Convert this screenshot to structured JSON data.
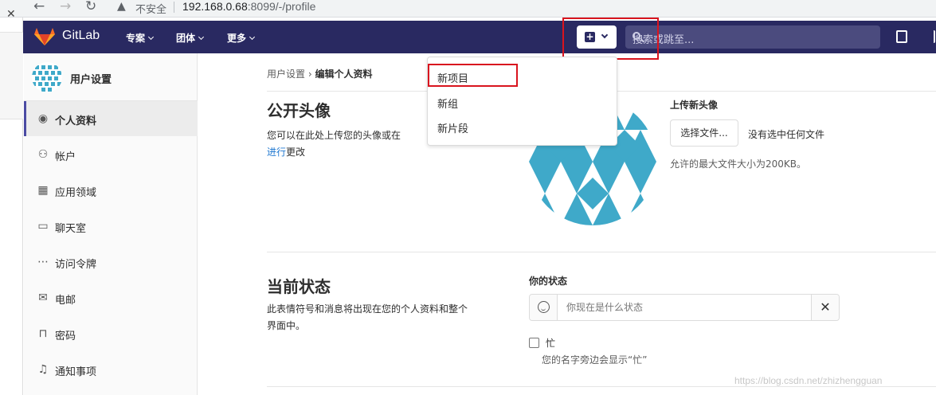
{
  "browser": {
    "back_icon": "back-arrow-icon",
    "forward_icon": "forward-arrow-icon",
    "reload_icon": "reload-icon",
    "insecure_label": "不安全",
    "url_host": "192.168.0.68",
    "url_path": ":8099/-/profile"
  },
  "navbar": {
    "brand": "GitLab",
    "menus": [
      "专案",
      "团体",
      "更多"
    ],
    "search_placeholder": "搜索或跳至..."
  },
  "dropdown": {
    "items": [
      "新项目",
      "新组",
      "新片段"
    ]
  },
  "sidebar": {
    "title": "用户设置",
    "items": [
      {
        "label": "个人资料",
        "icon": "profile-icon",
        "active": true
      },
      {
        "label": "帐户",
        "icon": "account-icon"
      },
      {
        "label": "应用领域",
        "icon": "applications-icon"
      },
      {
        "label": "聊天室",
        "icon": "chat-icon"
      },
      {
        "label": "访问令牌",
        "icon": "token-icon"
      },
      {
        "label": "电邮",
        "icon": "email-icon"
      },
      {
        "label": "密码",
        "icon": "lock-icon"
      },
      {
        "label": "通知事项",
        "icon": "bell-icon"
      }
    ]
  },
  "breadcrumb": {
    "parent": "用户设置",
    "current": "编辑个人资料"
  },
  "avatar_section": {
    "heading": "公开头像",
    "desc_line1": "您可以在此处上传您的头像或在",
    "desc_link_partial": "进行",
    "desc_suffix": "更改",
    "upload_title": "上传新头像",
    "choose_button": "选择文件...",
    "no_file": "没有选中任何文件",
    "max_size": "允许的最大文件大小为200KB。"
  },
  "status_section": {
    "heading": "当前状态",
    "desc_line1": "此表情符号和消息将出现在您的个人资料和整个",
    "desc_line2": "界面中。",
    "label": "你的状态",
    "placeholder": "你现在是什么状态",
    "clear_glyph": "✕",
    "busy_label": "忙",
    "busy_help": "您的名字旁边会显示“忙”"
  },
  "watermark": "https://blog.csdn.net/zhizhengguan",
  "colors": {
    "navbar": "#292961",
    "accent": "#1f78d1",
    "highlight_box": "#d9141e",
    "avatar_pattern": "#3fa9c9"
  }
}
